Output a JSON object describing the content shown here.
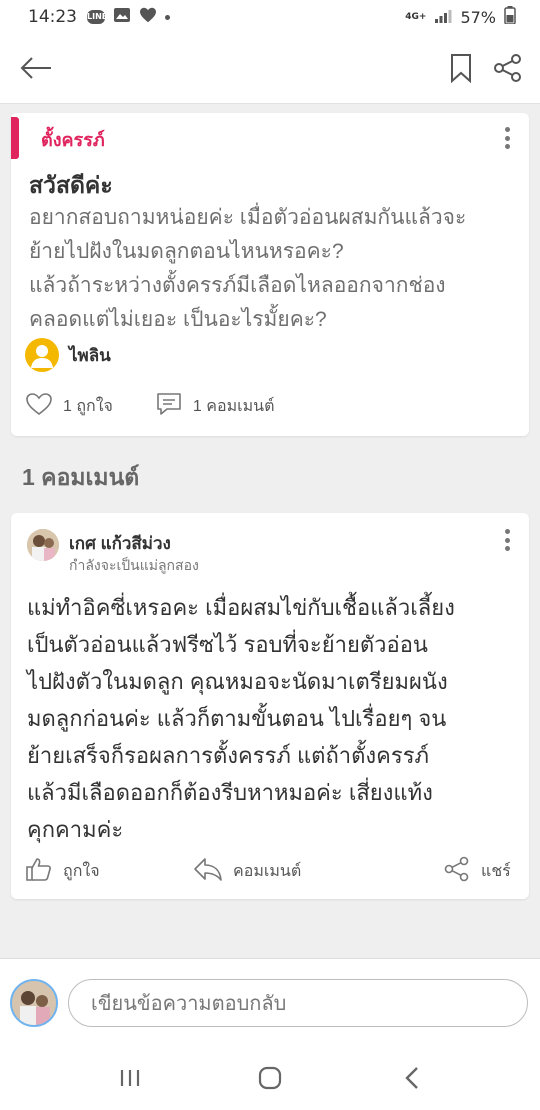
{
  "status_bar": {
    "time": "14:23",
    "signal": "4G+",
    "battery": "57%",
    "notification_icons": [
      "line-icon",
      "image-icon",
      "heart-icon"
    ]
  },
  "top_bar": {
    "icons": [
      "back-arrow-icon",
      "bookmark-icon",
      "share-icon"
    ]
  },
  "post": {
    "category": "ตั้งครรภ์",
    "title": "สวัสดีค่ะ",
    "body_lines": [
      "อยากสอบถามหน่อยค่ะ เมื่อตัวอ่อนผสมกันแล้วจะ",
      "ย้ายไปฝังในมดลูกตอนไหนหรอคะ?",
      "แล้วถ้าระหว่างตั้งครรภ์มีเลือดไหลออกจากช่อง",
      "คลอดแต่ไม่เยอะ เป็นอะไรมั้ยคะ?"
    ],
    "author": "ไพลิน",
    "likes": "1 ถูกใจ",
    "comments": "1 คอมเมนต์"
  },
  "comments_heading": "1 คอมเมนต์",
  "comment": {
    "author": "เกศ แก้วสีม่วง",
    "status": "กำลังจะเป็นแม่ลูกสอง",
    "body_lines": [
      "แม่ทำอิคซี่เหรอคะ เมื่อผสมไข่กับเชื้อแล้วเลี้ยง",
      "เป็นตัวอ่อนแล้วฟรีซไว้ รอบที่จะย้ายตัวอ่อน",
      "ไปฝังตัวในมดลูก คุณหมอจะนัดมาเตรียมผนัง",
      "มดลูกก่อนค่ะ แล้วก็ตามขั้นตอน ไปเรื่อยๆ จน",
      "ย้ายเสร็จก็รอผลการตั้งครรภ์ แต่ถ้าตั้งครรภ์",
      "แล้วมีเลือดออกก็ต้องรีบหาหมอค่ะ เสี่ยงแท้ง",
      "คุกคามค่ะ"
    ],
    "like_label": "ถูกใจ",
    "reply_label": "คอมเมนต์",
    "share_label": "แชร์"
  },
  "reply": {
    "placeholder": "เขียนข้อความตอบกลับ"
  },
  "nav_bar": {
    "icons": [
      "recent-apps-icon",
      "home-icon",
      "back-icon"
    ]
  },
  "colors": {
    "accent": "#e0245e",
    "background": "#efefef",
    "card": "#ffffff"
  }
}
